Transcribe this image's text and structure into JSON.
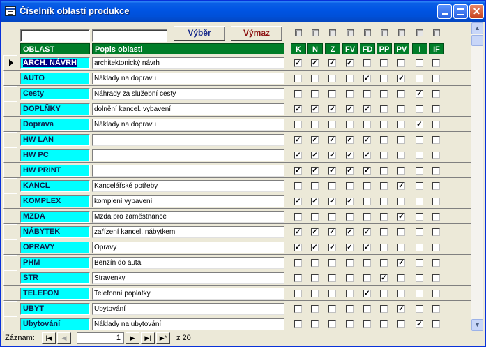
{
  "window": {
    "title": "Číselník oblastí produkce"
  },
  "buttons": {
    "vyber": "Výběr",
    "vymaz": "Výmaz"
  },
  "headers": {
    "oblast": "OBLAST",
    "popis": "Popis oblasti",
    "columns": [
      "K",
      "N",
      "Z",
      "FV",
      "FD",
      "PP",
      "PV",
      "I",
      "IF"
    ]
  },
  "rows": [
    {
      "oblast": "ARCH. NÁVRH",
      "popis": "architektonický návrh",
      "checks": [
        1,
        1,
        1,
        1,
        0,
        0,
        0,
        0,
        0
      ],
      "current": true
    },
    {
      "oblast": "AUTO",
      "popis": "Náklady na dopravu",
      "checks": [
        0,
        0,
        0,
        0,
        1,
        0,
        1,
        0,
        0
      ]
    },
    {
      "oblast": "Cesty",
      "popis": "Náhrady za služební cesty",
      "checks": [
        0,
        0,
        0,
        0,
        0,
        0,
        0,
        1,
        0
      ]
    },
    {
      "oblast": "DOPLŇKY",
      "popis": "dolnění kancel. vybavení",
      "checks": [
        1,
        1,
        1,
        1,
        1,
        0,
        0,
        0,
        0
      ]
    },
    {
      "oblast": "Doprava",
      "popis": "Náklady na dopravu",
      "checks": [
        0,
        0,
        0,
        0,
        0,
        0,
        0,
        1,
        0
      ]
    },
    {
      "oblast": "HW LAN",
      "popis": "",
      "checks": [
        1,
        1,
        1,
        1,
        1,
        0,
        0,
        0,
        0
      ]
    },
    {
      "oblast": "HW PC",
      "popis": "",
      "checks": [
        1,
        1,
        1,
        1,
        1,
        0,
        0,
        0,
        0
      ]
    },
    {
      "oblast": "HW PRINT",
      "popis": "",
      "checks": [
        1,
        1,
        1,
        1,
        1,
        0,
        0,
        0,
        0
      ]
    },
    {
      "oblast": "KANCL",
      "popis": "Kancelářské potřeby",
      "checks": [
        0,
        0,
        0,
        0,
        0,
        0,
        1,
        0,
        0
      ]
    },
    {
      "oblast": "KOMPLEX",
      "popis": "komplení vybavení",
      "checks": [
        1,
        1,
        1,
        1,
        0,
        0,
        0,
        0,
        0
      ]
    },
    {
      "oblast": "MZDA",
      "popis": "Mzda pro zaměstnance",
      "checks": [
        0,
        0,
        0,
        0,
        0,
        0,
        1,
        0,
        0
      ]
    },
    {
      "oblast": "NÁBYTEK",
      "popis": "zařízení kancel. nábytkem",
      "checks": [
        1,
        1,
        1,
        1,
        1,
        0,
        0,
        0,
        0
      ]
    },
    {
      "oblast": "OPRAVY",
      "popis": "Opravy",
      "checks": [
        1,
        1,
        1,
        1,
        1,
        0,
        0,
        0,
        0
      ]
    },
    {
      "oblast": "PHM",
      "popis": "Benzín do auta",
      "checks": [
        0,
        0,
        0,
        0,
        0,
        0,
        1,
        0,
        0
      ]
    },
    {
      "oblast": "STR",
      "popis": "Stravenky",
      "checks": [
        0,
        0,
        0,
        0,
        0,
        1,
        0,
        0,
        0
      ]
    },
    {
      "oblast": "TELEFON",
      "popis": "Telefonní poplatky",
      "checks": [
        0,
        0,
        0,
        0,
        1,
        0,
        0,
        0,
        0
      ]
    },
    {
      "oblast": "UBYT",
      "popis": "Ubytování",
      "checks": [
        0,
        0,
        0,
        0,
        0,
        0,
        1,
        0,
        0
      ]
    },
    {
      "oblast": "Ubytování",
      "popis": "Náklady na ubytování",
      "checks": [
        0,
        0,
        0,
        0,
        0,
        0,
        0,
        1,
        0
      ]
    }
  ],
  "navigator": {
    "label": "Záznam:",
    "current": "1",
    "total_text": "z  20"
  }
}
